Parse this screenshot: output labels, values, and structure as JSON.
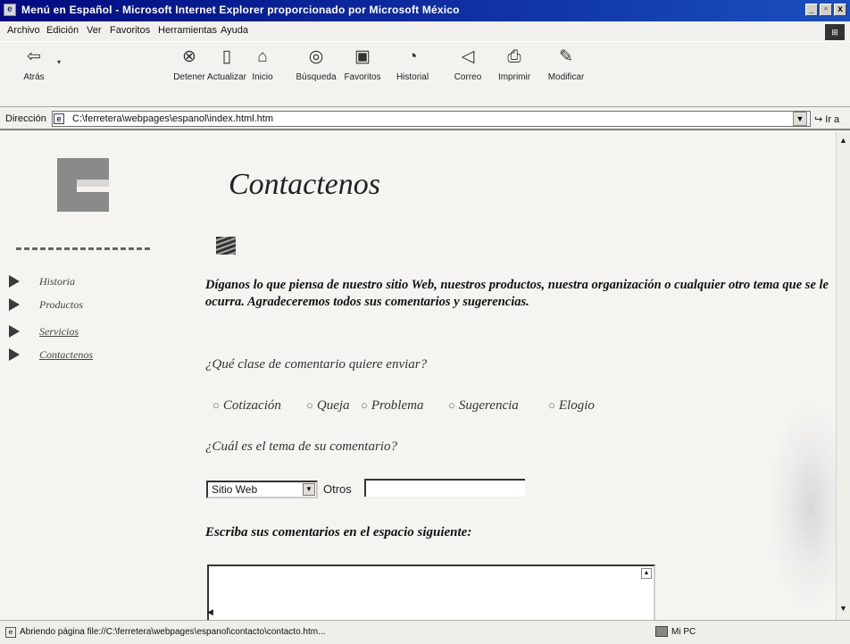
{
  "window": {
    "title": "Menú en Español - Microsoft Internet Explorer proporcionado por Microsoft México",
    "controls": {
      "minimize": "_",
      "maximize": "▫",
      "close": "x"
    }
  },
  "menu": [
    {
      "label": "Archivo"
    },
    {
      "label": "Edición"
    },
    {
      "label": "Ver"
    },
    {
      "label": "Favoritos"
    },
    {
      "label": "Herramientas"
    },
    {
      "label": "Ayuda"
    }
  ],
  "toolbar": {
    "back": {
      "label": "Atrás",
      "icon": "back-arrow-icon"
    },
    "stop": {
      "label": "Detener",
      "icon": "stop-icon"
    },
    "refresh": {
      "label": "Actualizar",
      "icon": "refresh-icon"
    },
    "home": {
      "label": "Inicio",
      "icon": "home-icon"
    },
    "search": {
      "label": "Búsqueda",
      "icon": "search-icon"
    },
    "favorites": {
      "label": "Favoritos",
      "icon": "favorites-icon"
    },
    "history": {
      "label": "Historial",
      "icon": "history-icon"
    },
    "mail": {
      "label": "Correo",
      "icon": "mail-icon"
    },
    "print": {
      "label": "Imprimir",
      "icon": "print-icon"
    },
    "edit": {
      "label": "Modificar",
      "icon": "edit-icon"
    }
  },
  "address": {
    "label": "Dirección",
    "url": "C:\\ferretera\\webpages\\espanol\\index.html.htm",
    "go_label": "Ir a"
  },
  "sidebar": {
    "items": [
      {
        "label": "Historia"
      },
      {
        "label": "Productos"
      },
      {
        "label": "Servicios"
      },
      {
        "label": "Contactenos"
      }
    ]
  },
  "main": {
    "title": "Contactenos",
    "intro": "Díganos lo que piensa de nuestro sitio Web, nuestros productos, nuestra organización o cualquier otro tema que se le ocurra. Agradeceremos todos sus comentarios y sugerencias.",
    "question_type": "¿Qué clase de comentario quiere enviar?",
    "options": [
      {
        "label": "Cotización"
      },
      {
        "label": "Queja"
      },
      {
        "label": "Problema"
      },
      {
        "label": "Sugerencia"
      },
      {
        "label": "Elogio"
      }
    ],
    "question_topic": "¿Cuál es el tema de su comentario?",
    "topic_select": "Sitio Web",
    "others_label": "Otros",
    "comments_label": "Escriba sus comentarios en el espacio siguiente:"
  },
  "status": {
    "text": "Abriendo página file://C:\\ferretera\\webpages\\espanol\\contacto\\contacto.htm...",
    "zone": "Mi PC"
  }
}
